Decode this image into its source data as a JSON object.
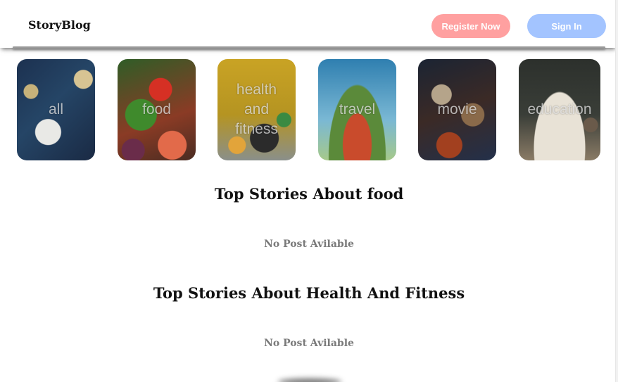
{
  "navbar": {
    "brand": "StoryBlog",
    "register_label": "Register Now",
    "signin_label": "Sign In",
    "register_color": "#ffa0a0",
    "signin_color": "#a3c4ff"
  },
  "categories": [
    {
      "label": "all"
    },
    {
      "label": "food"
    },
    {
      "label": "health and fitness"
    },
    {
      "label": "travel"
    },
    {
      "label": "movie"
    },
    {
      "label": "education"
    }
  ],
  "sections": [
    {
      "title": "Top Stories About food",
      "empty_message": "No Post Avilable"
    },
    {
      "title": "Top Stories About Health And Fitness",
      "empty_message": "No Post Avilable"
    }
  ]
}
